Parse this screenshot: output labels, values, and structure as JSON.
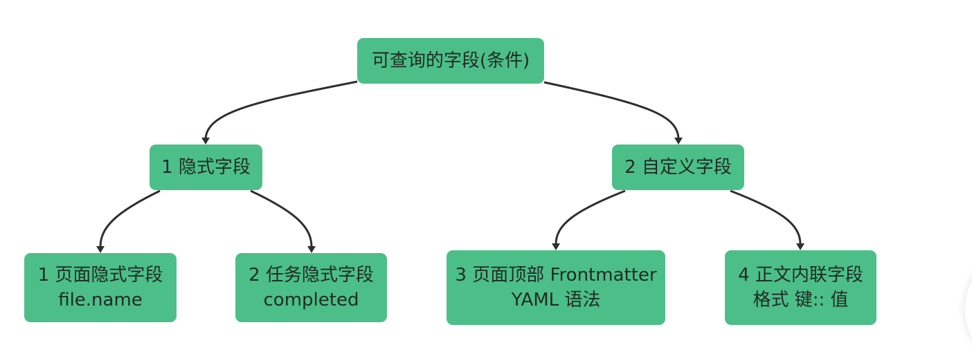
{
  "diagram": {
    "root": {
      "label": "可查询的字段(条件)"
    },
    "branches": [
      {
        "label": "1 隐式字段",
        "children": [
          {
            "lines": [
              "1 页面隐式字段",
              "file.name"
            ]
          },
          {
            "lines": [
              "2 任务隐式字段",
              "completed"
            ]
          }
        ]
      },
      {
        "label": "2 自定义字段",
        "children": [
          {
            "lines": [
              "3 页面顶部 Frontmatter",
              "YAML 语法"
            ]
          },
          {
            "lines": [
              "4 正文内联字段",
              "格式 键:: 值"
            ]
          }
        ]
      }
    ],
    "colors": {
      "node_fill": "#4cbf88",
      "node_text": "#1f2a24",
      "edge": "#2e2e2e",
      "background": "#ffffff"
    }
  }
}
